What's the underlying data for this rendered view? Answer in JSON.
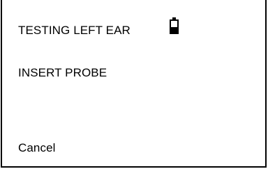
{
  "screen": {
    "title": "TESTING LEFT EAR",
    "instruction": "INSERT PROBE",
    "cancel_label": "Cancel"
  },
  "battery": {
    "icon": "battery-icon",
    "level": 0.45
  },
  "colors": {
    "text": "#000000",
    "background": "#ffffff",
    "border": "#000000"
  }
}
